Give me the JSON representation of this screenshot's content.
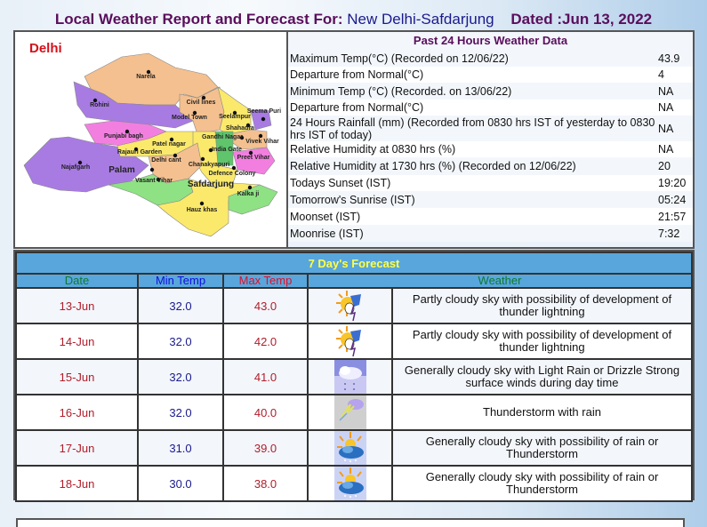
{
  "header": {
    "title_prefix": "Local Weather Report and Forecast For:",
    "station": "New Delhi-Safdarjung",
    "dated": "Dated :Jun 13, 2022"
  },
  "map": {
    "title": "Delhi",
    "labels": [
      "Narela",
      "Rohini",
      "Civil lines",
      "Model Town",
      "Seelampur",
      "Seema Puri",
      "Shahadra",
      "Punjabi bagh",
      "Gandhi Nagar",
      "Vivek Vihar",
      "Patel nagar",
      "Rajauri Garden",
      "India Gate",
      "Preet Vihar",
      "Delhi cant",
      "Chanakyapuri",
      "Najafgarh",
      "Palam",
      "Defence Colony",
      "Vasant Vihar",
      "Safdarjung",
      "Kalka ji",
      "Hauz khas"
    ]
  },
  "past24": {
    "title": "Past 24 Hours Weather Data",
    "rows": [
      {
        "label": "Maximum Temp(°C) (Recorded on 12/06/22)",
        "value": "43.9"
      },
      {
        "label": "Departure from Normal(°C)",
        "value": "4"
      },
      {
        "label": "Minimum Temp (°C) (Recorded. on 13/06/22)",
        "value": "NA"
      },
      {
        "label": "Departure from Normal(°C)",
        "value": "NA"
      },
      {
        "label": "24 Hours Rainfall (mm) (Recorded from 0830 hrs IST of yesterday to 0830 hrs IST of today)",
        "value": "NA"
      },
      {
        "label": "Relative Humidity at 0830 hrs (%)",
        "value": "NA"
      },
      {
        "label": "Relative Humidity at 1730 hrs (%) (Recorded on 12/06/22)",
        "value": "20"
      },
      {
        "label": "Todays Sunset (IST)",
        "value": "19:20"
      },
      {
        "label": "Tomorrow's Sunrise (IST)",
        "value": "05:24"
      },
      {
        "label": "Moonset (IST)",
        "value": "21:57"
      },
      {
        "label": "Moonrise (IST)",
        "value": "7:32"
      }
    ]
  },
  "forecast": {
    "title": "7 Day's Forecast",
    "headers": {
      "date": "Date",
      "min": "Min Temp",
      "max": "Max Temp",
      "weather": "Weather"
    },
    "rows": [
      {
        "date": "13-Jun",
        "min": "32.0",
        "max": "43.0",
        "icon": "sun-thunder-icon",
        "weather": "Partly cloudy sky with possibility of development of thunder lightning"
      },
      {
        "date": "14-Jun",
        "min": "32.0",
        "max": "42.0",
        "icon": "sun-thunder-icon",
        "weather": "Partly cloudy sky with possibility of development of thunder lightning"
      },
      {
        "date": "15-Jun",
        "min": "32.0",
        "max": "41.0",
        "icon": "cloud-drizzle-icon",
        "weather": "Generally cloudy sky with Light Rain or Drizzle Strong surface winds during day time"
      },
      {
        "date": "16-Jun",
        "min": "32.0",
        "max": "40.0",
        "icon": "thunderstorm-icon",
        "weather": "Thunderstorm with rain"
      },
      {
        "date": "17-Jun",
        "min": "31.0",
        "max": "39.0",
        "icon": "sun-cloud-rain-icon",
        "weather": "Generally cloudy sky with possibility of rain or Thunderstorm"
      },
      {
        "date": "18-Jun",
        "min": "30.0",
        "max": "38.0",
        "icon": "sun-cloud-rain-icon",
        "weather": "Generally cloudy sky with possibility of rain or Thunderstorm"
      }
    ]
  },
  "colors": {
    "title": "#5a0e5c",
    "forecast_header_bg": "#59a6dc",
    "forecast_title": "#ffff44",
    "date_header": "#0d7a2e",
    "min_header": "#1010dd",
    "max_header": "#e0102a"
  }
}
